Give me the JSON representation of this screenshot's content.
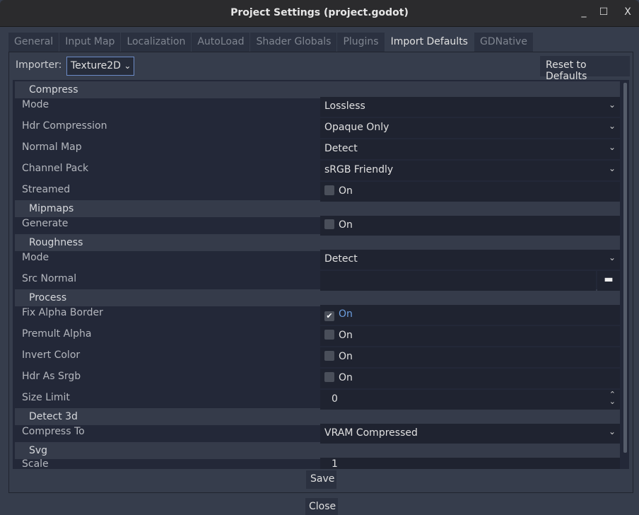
{
  "window": {
    "title": "Project Settings (project.godot)",
    "minimize": "_",
    "maximize": "☐",
    "close": "X"
  },
  "tabs": [
    {
      "label": "General"
    },
    {
      "label": "Input Map"
    },
    {
      "label": "Localization"
    },
    {
      "label": "AutoLoad"
    },
    {
      "label": "Shader Globals"
    },
    {
      "label": "Plugins"
    },
    {
      "label": "Import Defaults",
      "selected": true
    },
    {
      "label": "GDNative"
    }
  ],
  "importer": {
    "label": "Importer:",
    "value": "Texture2D"
  },
  "reset_label": "Reset to Defaults",
  "sections": {
    "compress": "Compress",
    "mipmaps": "Mipmaps",
    "roughness": "Roughness",
    "process": "Process",
    "detect3d": "Detect 3d",
    "svg": "Svg"
  },
  "props": {
    "compress_mode": {
      "label": "Mode",
      "value": "Lossless"
    },
    "hdr_compression": {
      "label": "Hdr Compression",
      "value": "Opaque Only"
    },
    "normal_map": {
      "label": "Normal Map",
      "value": "Detect"
    },
    "channel_pack": {
      "label": "Channel Pack",
      "value": "sRGB Friendly"
    },
    "streamed": {
      "label": "Streamed",
      "value": "On",
      "checked": false
    },
    "generate": {
      "label": "Generate",
      "value": "On",
      "checked": false
    },
    "roughness_mode": {
      "label": "Mode",
      "value": "Detect"
    },
    "src_normal": {
      "label": "Src Normal",
      "value": ""
    },
    "fix_alpha_border": {
      "label": "Fix Alpha Border",
      "value": "On",
      "checked": true
    },
    "premult_alpha": {
      "label": "Premult Alpha",
      "value": "On",
      "checked": false
    },
    "invert_color": {
      "label": "Invert Color",
      "value": "On",
      "checked": false
    },
    "hdr_as_srgb": {
      "label": "Hdr As Srgb",
      "value": "On",
      "checked": false
    },
    "size_limit": {
      "label": "Size Limit",
      "value": "0"
    },
    "compress_to": {
      "label": "Compress To",
      "value": "VRAM Compressed"
    },
    "scale": {
      "label": "Scale",
      "value": "1"
    }
  },
  "save_label": "Save",
  "close_label": "Close",
  "colors": {
    "accent": "#6d9fe0",
    "background": "#363d4c",
    "panel": "#232838"
  }
}
